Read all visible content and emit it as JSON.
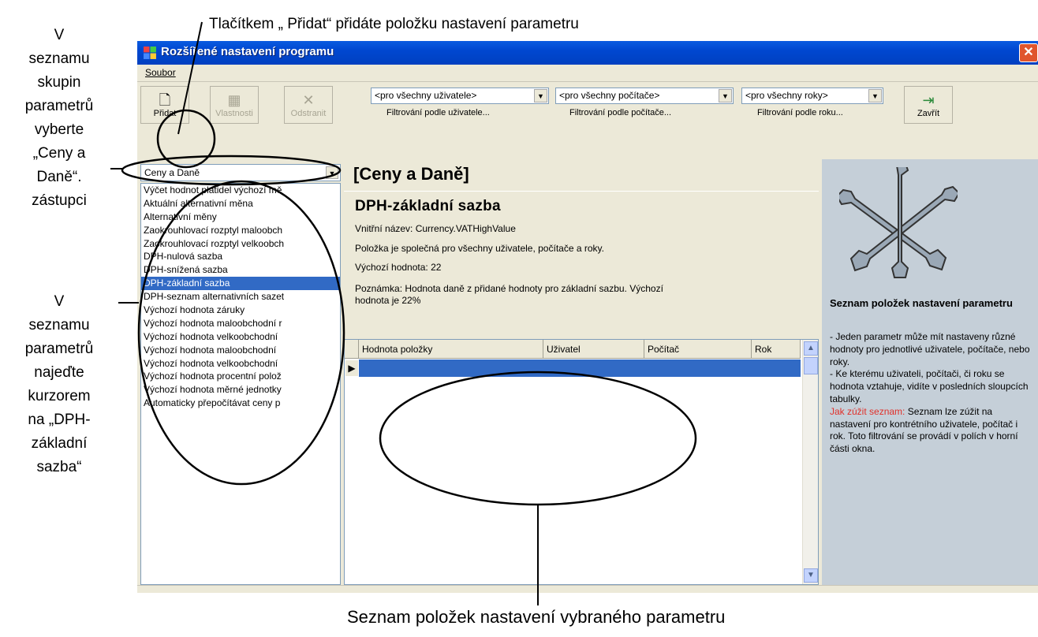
{
  "annotations": {
    "top": "Tlačítkem „ Přidat“ přidáte položku nastavení parametru",
    "left1": [
      "V",
      "seznamu",
      "skupin",
      "parametrů",
      "vyberte",
      "„Ceny a",
      "Daně“.",
      "zástupci"
    ],
    "left2": [
      "V",
      "seznamu",
      "parametrů",
      "najeďte",
      "kurzorem",
      "na „DPH-",
      "základní",
      "sazba“"
    ],
    "bottom": "Seznam položek nastavení vybraného parametru"
  },
  "window": {
    "title": "Rozšířené nastavení programu",
    "close": "✕",
    "menu": "Soubor"
  },
  "toolbar": {
    "add": "Přidat",
    "props": "Vlastnosti",
    "remove": "Odstranit",
    "close": "Zavřít"
  },
  "filters": {
    "user": "<pro všechny uživatele>",
    "user_label": "Filtrování podle uživatele...",
    "pc": "<pro všechny počítače>",
    "pc_label": "Filtrování podle počítače...",
    "year": "<pro všechny roky>",
    "year_label": "Filtrování podle roku..."
  },
  "left": {
    "group": "Ceny a Daně",
    "items": [
      "Výčet hodnot platidel výchozí mě",
      "Aktuální alternativní měna",
      "Alternativní měny",
      "Zaokrouhlovací rozptyl maloobch",
      "Zaokrouhlovací rozptyl velkoobch",
      "DPH-nulová sazba",
      "DPH-snížená sazba",
      "DPH-základní sazba",
      "DPH-seznam alternativních sazet",
      "Výchozí hodnota záruky",
      "Výchozí hodnota maloobchodní r",
      "Výchozí hodnota velkoobchodní",
      "Výchozí hodnota maloobchodní",
      "Výchozí hodnota velkoobchodní",
      "Výchozí hodnota procentní polož",
      "Výchozí hodnota měrné jednotky",
      "Automaticky přepočítávat ceny p"
    ],
    "selected_index": 7
  },
  "center": {
    "group_title": "[Ceny a Daně]",
    "item_title": "DPH-základní sazba",
    "internal": "Vnitřní název: Currency.VATHighValue",
    "common": "Položka je společná pro všechny uživatele, počítače a roky.",
    "default": "Výchozí hodnota: 22",
    "note1": "Poznámka: Hodnota daně z přidané hodnoty pro základní sazbu. Výchozí",
    "note2": "hodnota je 22%",
    "grid_headers": [
      "Hodnota položky",
      "Uživatel",
      "Počítač",
      "Rok"
    ]
  },
  "help": {
    "title": "Seznam položek nastavení parametru",
    "b1": "- Jeden parametr může mít nastaveny různé hodnoty pro jednotlivé uživatele, počítače, nebo roky.",
    "b2": "- Ke kterému uživateli, počítači, či roku se hodnota vztahuje, vidíte v posledních sloupcích tabulky.",
    "red": "Jak zúžit seznam:",
    "b3": " Seznam lze zúžit na nastavení pro kontrétního uživatele, počítač i rok. Toto filtrování se provádí v polích v horní části okna."
  }
}
